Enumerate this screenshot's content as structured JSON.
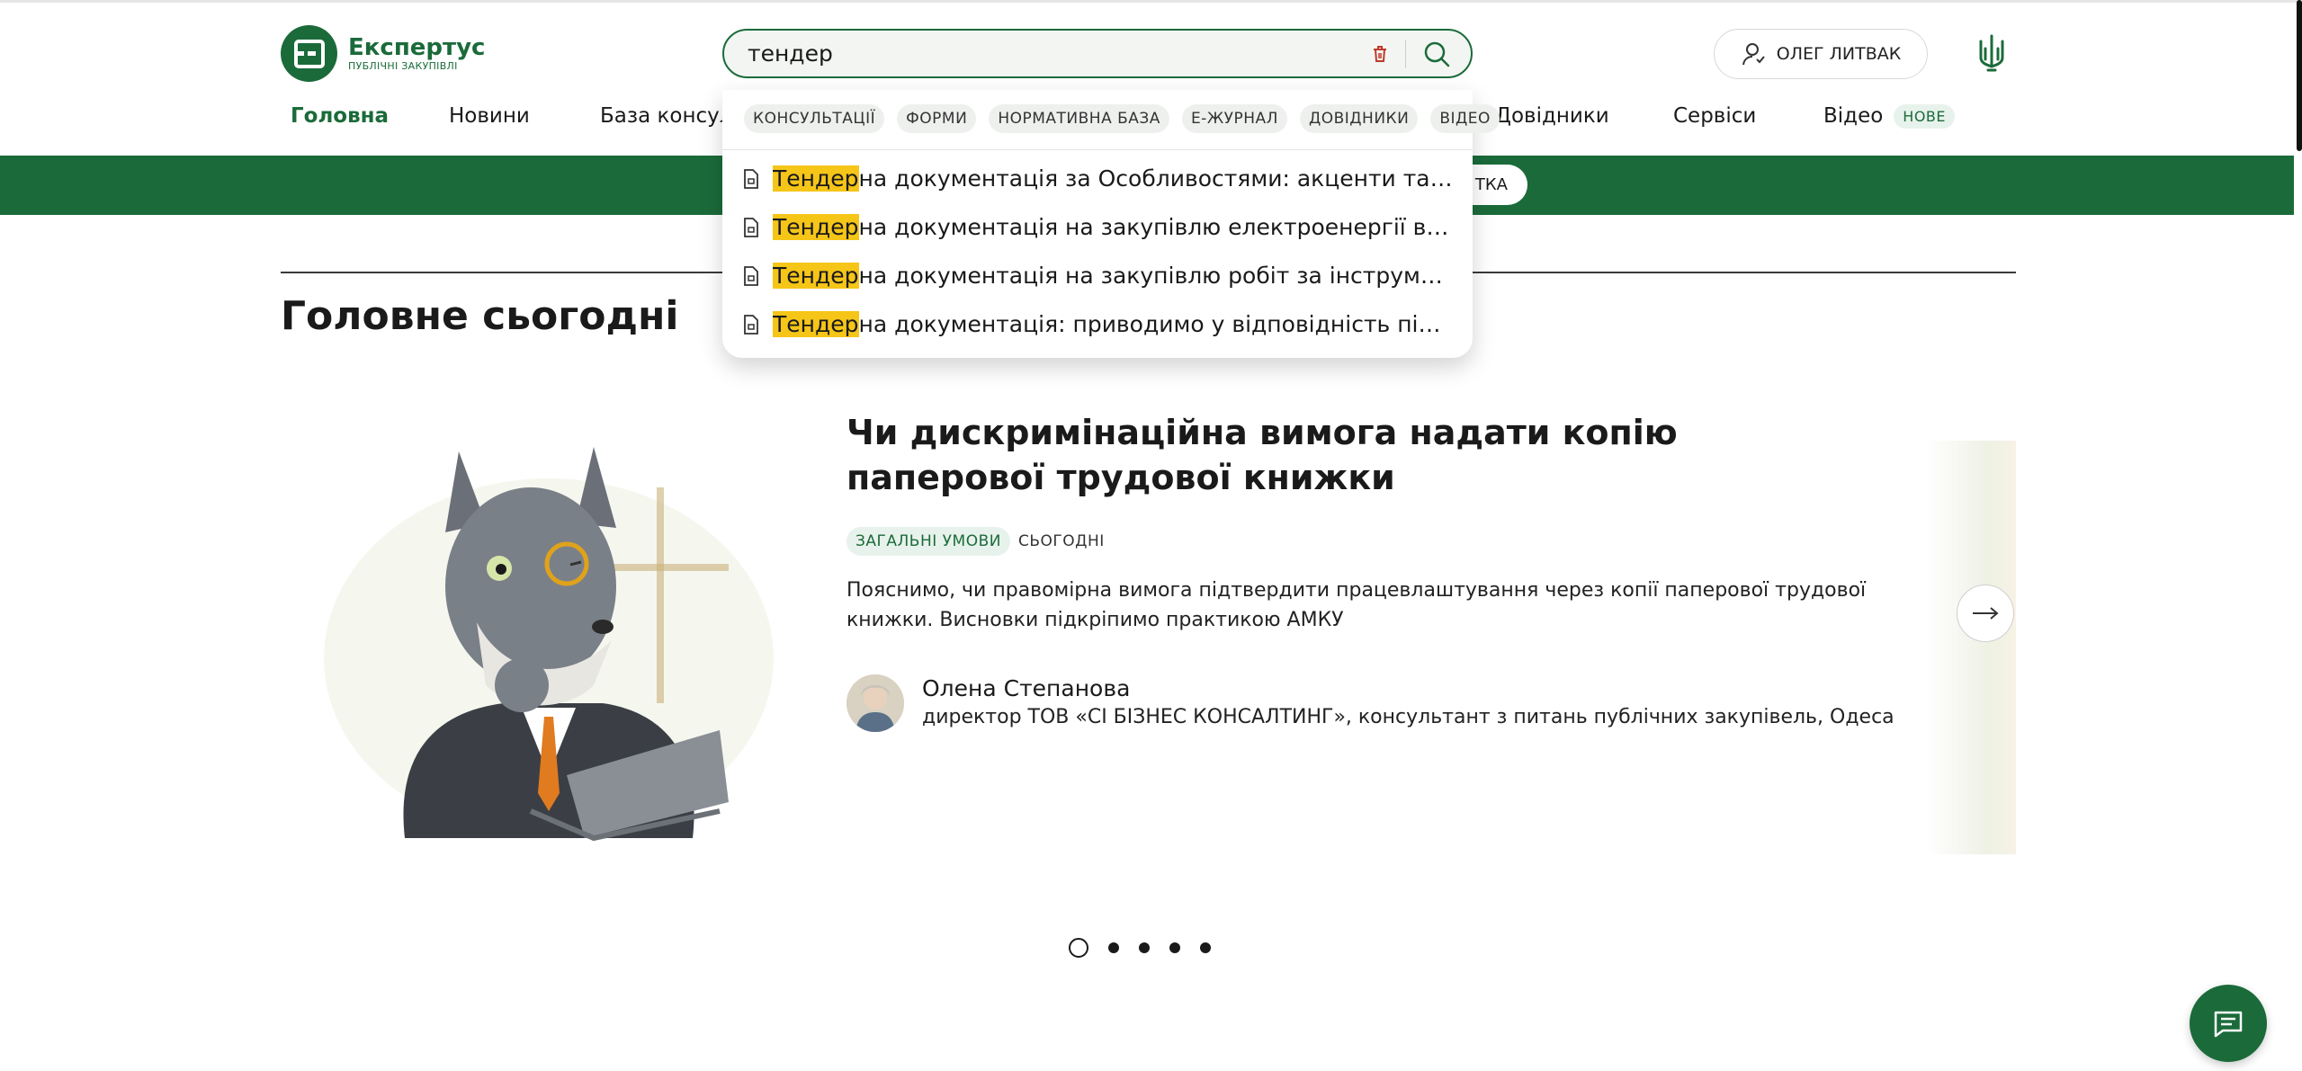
{
  "brand": {
    "name": "Експертус",
    "subtitle": "ПУБЛІЧНІ ЗАКУПІВЛІ"
  },
  "search": {
    "value": "тендер",
    "placeholder": ""
  },
  "user": {
    "name": "ОЛЕГ ЛИТВАК"
  },
  "nav": [
    {
      "label": "Головна",
      "active": true
    },
    {
      "label": "Новини"
    },
    {
      "label": "База консульта"
    },
    {
      "label": "Довідники"
    },
    {
      "label": "Сервіси"
    },
    {
      "label": "Відео",
      "badge": "НОВЕ"
    }
  ],
  "banner": {
    "pill_label": "ТКА"
  },
  "dropdown": {
    "chips": [
      "КОНСУЛЬТАЦІЇ",
      "ФОРМИ",
      "НОРМАТИВНА БАЗА",
      "Е-ЖУРНАЛ",
      "ДОВІДНИКИ",
      "ВІДЕО"
    ],
    "results": [
      {
        "highlight": "Тендер",
        "rest": "на документація за Особливостями: акценти та поради"
      },
      {
        "highlight": "Тендер",
        "rest": "на документація на закупівлю електроенергії від Міно…"
      },
      {
        "highlight": "Тендер",
        "rest": "на документація на закупівлю робіт за інструментом U…"
      },
      {
        "highlight": "Тендер",
        "rest": "на документація: приводимо у відповідність після змін…"
      }
    ]
  },
  "section": {
    "title": "Головне сьогодні"
  },
  "article": {
    "title": "Чи дискримінаційна вимога надати копію паперової трудової книжки",
    "category": "ЗАГАЛЬНІ УМОВИ",
    "date": "СЬОГОДНІ",
    "lead": "Пояснимо, чи правомірна вимога підтвердити працевлаштування через копії паперової трудової книжки. Висновки підкріпимо практикою АМКУ",
    "author_name": "Олена Степанова",
    "author_position": "директор ТОВ «СІ БІЗНЕС КОНСАЛТИНГ», консультант з питань публічних закупівель, Одеса"
  },
  "carousel": {
    "slides": 5,
    "active": 1
  },
  "colors": {
    "brand_green": "#1b6b3a",
    "highlight": "#f5c518",
    "chip_bg": "#eef0ee"
  },
  "icons": [
    "logo-icon",
    "trash-icon",
    "search-icon",
    "user-icon",
    "trident-icon",
    "document-icon",
    "arrow-right-icon",
    "chat-icon"
  ]
}
